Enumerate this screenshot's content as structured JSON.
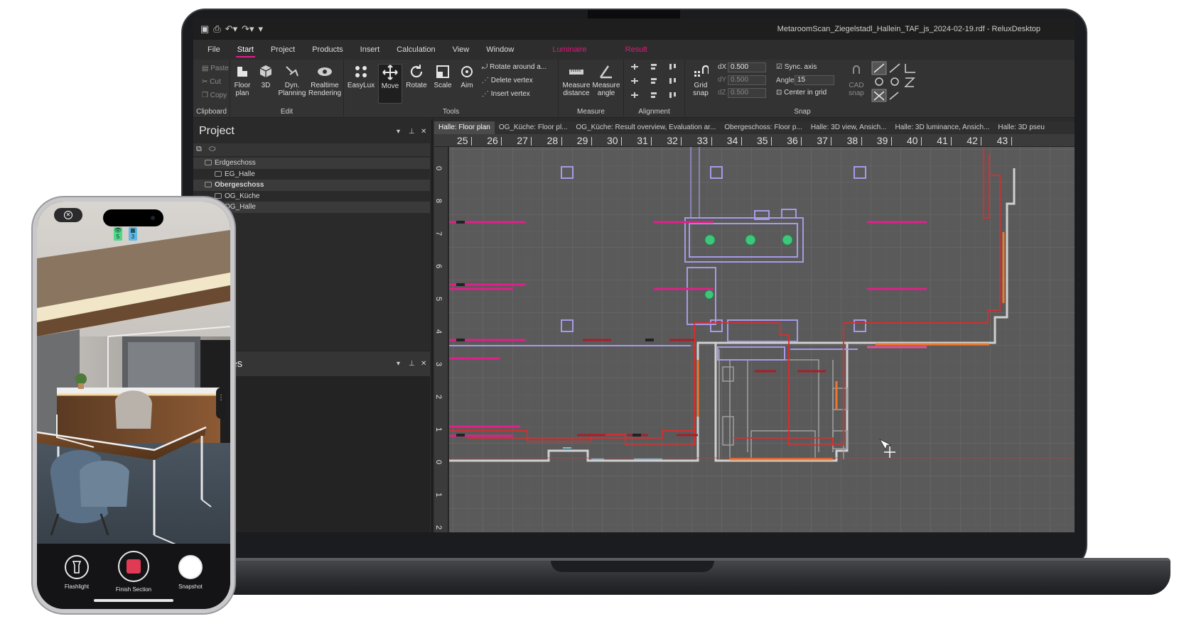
{
  "window": {
    "title": "MetaroomScan_Ziegelstadl_Hallein_TAF_js_2024-02-19.rdf - ReluxDesktop"
  },
  "menu": {
    "items": [
      "File",
      "Start",
      "Project",
      "Products",
      "Insert",
      "Calculation",
      "View",
      "Window"
    ],
    "active": "Start",
    "context_tabs": [
      "Luminaire",
      "Result"
    ]
  },
  "ribbon": {
    "clipboard": {
      "label": "Clipboard",
      "paste": "Paste",
      "cut": "Cut",
      "copy": "Copy"
    },
    "edit": {
      "label": "Edit",
      "floor_plan": "Floor\nplan",
      "three_d": "3D",
      "dyn_planning": "Dyn.\nPlanning",
      "realtime_rendering": "Realtime\nRendering"
    },
    "tools": {
      "label": "Tools",
      "easylux": "EasyLux",
      "move": "Move",
      "rotate": "Rotate",
      "scale": "Scale",
      "aim": "Aim",
      "rotate_around": "Rotate around a...",
      "delete_vertex": "Delete vertex",
      "insert_vertex": "Insert vertex"
    },
    "measure": {
      "label": "Measure",
      "measure_distance": "Measure\ndistance",
      "measure_angle": "Measure\nangle"
    },
    "alignment": {
      "label": "Alignment"
    },
    "snap": {
      "label": "Snap",
      "grid_snap": "Grid\nsnap",
      "dx_label": "dX",
      "dx_value": "0.500",
      "dy_label": "dY",
      "dy_value": "0.500",
      "dz_label": "dZ",
      "dz_value": "0.500",
      "sync_axis": "Sync. axis",
      "angle_label": "Angle",
      "angle_value": "15",
      "center_in_grid": "Center in grid",
      "cad_snap": "CAD\nsnap"
    }
  },
  "project_panel": {
    "title": "Project",
    "tree": [
      {
        "label": "Erdgeschoss",
        "level": 0,
        "bold": false
      },
      {
        "label": "EG_Halle",
        "level": 1,
        "bold": false
      },
      {
        "label": "Obergeschoss",
        "level": 0,
        "bold": true
      },
      {
        "label": "OG_Küche",
        "level": 1,
        "bold": false
      },
      {
        "label": "OG_Halle",
        "level": 1,
        "bold": false
      }
    ],
    "properties_title_fragment": "ies"
  },
  "document_tabs": [
    "Halle: Floor plan",
    "OG_Küche: Floor pl...",
    "OG_Küche: Result overview, Evaluation ar...",
    "Obergeschoss: Floor p...",
    "Halle: 3D view, Ansich...",
    "Halle: 3D luminance, Ansich...",
    "Halle: 3D pseu"
  ],
  "ruler": {
    "top": [
      "25",
      "26",
      "27",
      "28",
      "29",
      "30",
      "31",
      "32",
      "33",
      "34",
      "35",
      "36",
      "37",
      "38",
      "39",
      "40",
      "41",
      "42",
      "43"
    ],
    "left": [
      "0",
      "8",
      "7",
      "6",
      "5",
      "4",
      "3",
      "2",
      "1",
      "0",
      "1",
      "2"
    ]
  },
  "phone": {
    "badge_left": "5",
    "badge_right": "3",
    "controls": [
      {
        "label": "Flashlight",
        "icon": "flashlight-icon"
      },
      {
        "label": "Finish Section",
        "icon": "stop-icon"
      },
      {
        "label": "Snapshot",
        "icon": "shutter-icon"
      }
    ]
  },
  "colors": {
    "accent_pink": "#e0208a",
    "wall_red": "#e22a2a",
    "luminaire_lilac": "#a59be6",
    "grid_bg": "#5a5a5a"
  }
}
